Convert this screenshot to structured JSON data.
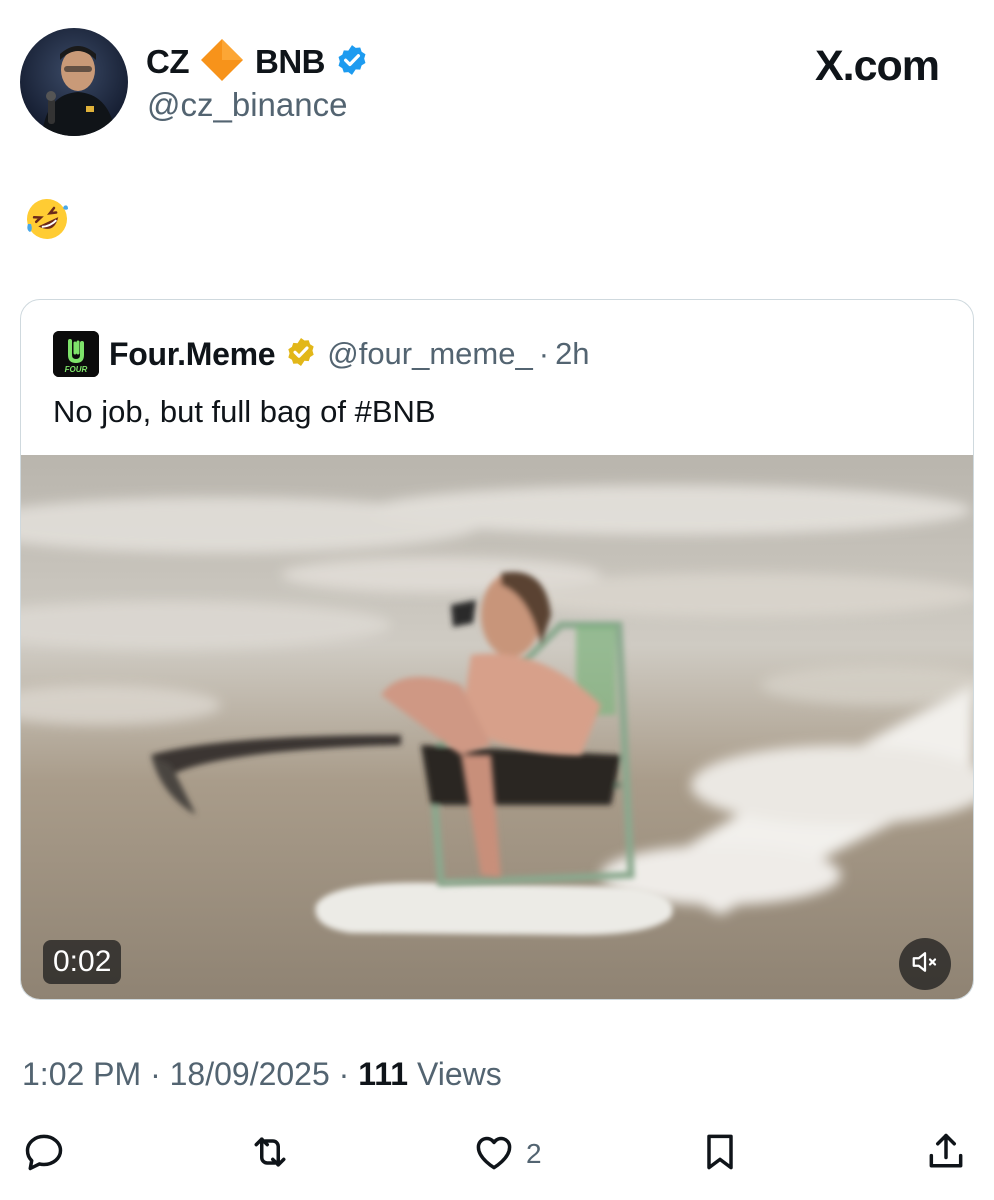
{
  "header": {
    "display_name": "CZ",
    "badge_icon": "orange-diamond-icon",
    "name_suffix": "BNB",
    "verified_icon": "verified-badge-icon",
    "handle": "@cz_binance",
    "brand": "X.com"
  },
  "tweet": {
    "text_emoji": "rolling-on-floor-laughing-emoji"
  },
  "quote": {
    "avatar_text": "FOUR",
    "name": "Four.Meme",
    "verified_icon": "gold-verified-badge-icon",
    "handle": "@four_meme_",
    "separator": "·",
    "time": "2h",
    "text": "No job, but full bag of #BNB",
    "media": {
      "duration": "0:02",
      "mute_icon": "muted-speaker-icon"
    }
  },
  "meta": {
    "time": "1:02 PM",
    "separator1": " · ",
    "date": "18/09/2025",
    "separator2": " · ",
    "views_count": "111",
    "views_label": " Views"
  },
  "actions": {
    "reply_icon": "reply-icon",
    "retweet_icon": "retweet-icon",
    "like_icon": "heart-icon",
    "like_count": "2",
    "bookmark_icon": "bookmark-icon",
    "share_icon": "share-icon"
  },
  "colors": {
    "text": "#0f1419",
    "secondary": "#536471",
    "border": "#cfd9de",
    "verified_blue": "#1d9bf0",
    "verified_gold": "#e2b719",
    "diamond_orange": "#f7931a"
  }
}
